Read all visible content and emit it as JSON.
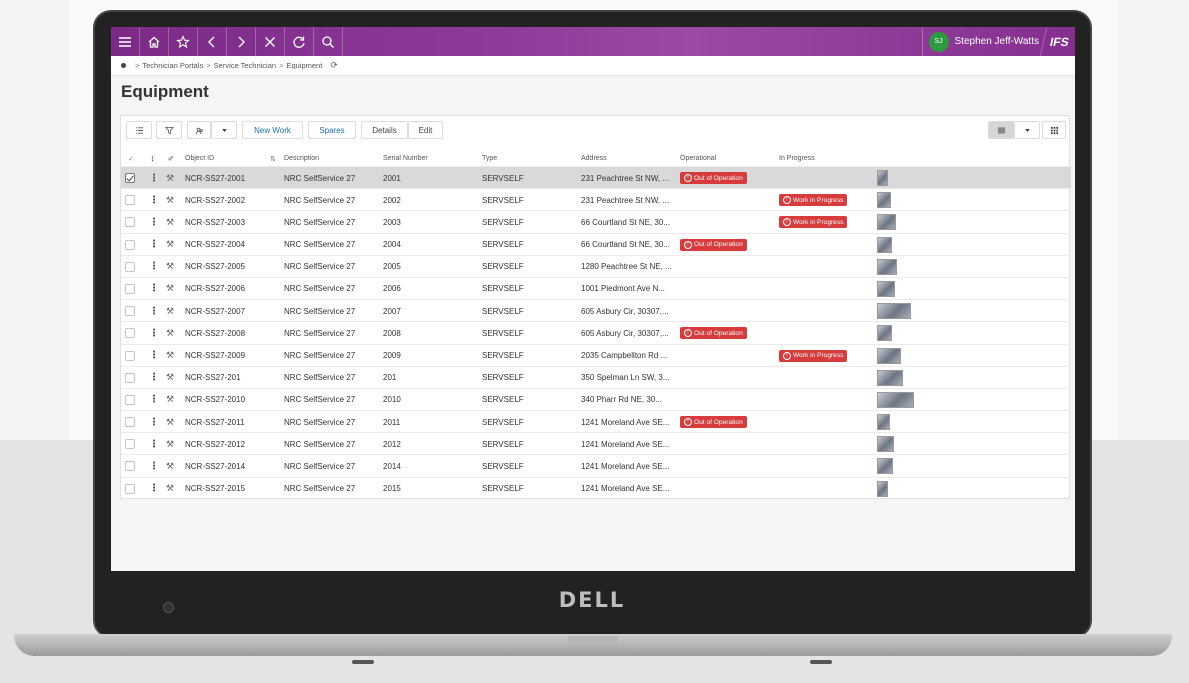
{
  "topbar": {
    "user_name": "Stephen Jeff-Watts",
    "user_initials": "SJ",
    "logo_text": "IFS",
    "colors": {
      "bar": "#8e3a99",
      "avatar": "#2e9a3f"
    },
    "icons": [
      "menu-icon",
      "home-icon",
      "star-icon",
      "chevron-left-icon",
      "chevron-right-icon",
      "close-icon",
      "refresh-icon",
      "search-icon"
    ]
  },
  "breadcrumb": {
    "items": [
      "Technician Portals",
      "Service Technician",
      "Equipment"
    ]
  },
  "page": {
    "title": "Equipment"
  },
  "toolbar": {
    "new_work": "New Work",
    "spares": "Spares",
    "details": "Details",
    "edit": "Edit"
  },
  "table": {
    "columns": {
      "object_id": "Object ID",
      "description": "Description",
      "serial_number": "Serial Number",
      "type": "Type",
      "address": "Address",
      "operational": "Operational",
      "in_progress": "In Progress"
    },
    "rows": [
      {
        "id": "NCR-SS27-2001",
        "desc": "NRC SelfService 27",
        "serial": "2001",
        "type": "SERVSELF",
        "address": "231 Peachtree St NW, ...",
        "operational": "Out of Operation",
        "progress": "",
        "selected": true
      },
      {
        "id": "NCR-SS27-2002",
        "desc": "NRC SelfService 27",
        "serial": "2002",
        "type": "SERVSELF",
        "address": "231 Peachtree St NW, ...",
        "operational": "",
        "progress": "Work in Progress"
      },
      {
        "id": "NCR-SS27-2003",
        "desc": "NRC SelfService 27",
        "serial": "2003",
        "type": "SERVSELF",
        "address": "66 Courtland St NE, 30...",
        "operational": "",
        "progress": "Work in Progress"
      },
      {
        "id": "NCR-SS27-2004",
        "desc": "NRC SelfService 27",
        "serial": "2004",
        "type": "SERVSELF",
        "address": "66 Courtland St NE, 30...",
        "operational": "Out of Operation",
        "progress": ""
      },
      {
        "id": "NCR-SS27-2005",
        "desc": "NRC SelfService 27",
        "serial": "2005",
        "type": "SERVSELF",
        "address": "1280 Peachtree St NE, ...",
        "operational": "",
        "progress": ""
      },
      {
        "id": "NCR-SS27-2006",
        "desc": "NRC SelfService 27",
        "serial": "2006",
        "type": "SERVSELF",
        "address": "1001 Piedmont Ave N...",
        "operational": "",
        "progress": ""
      },
      {
        "id": "NCR-SS27-2007",
        "desc": "NRC SelfService 27",
        "serial": "2007",
        "type": "SERVSELF",
        "address": "605 Asbury Cir, 30307,...",
        "operational": "",
        "progress": ""
      },
      {
        "id": "NCR-SS27-2008",
        "desc": "NRC SelfService 27",
        "serial": "2008",
        "type": "SERVSELF",
        "address": "605 Asbury Cir, 30307,...",
        "operational": "Out of Operation",
        "progress": ""
      },
      {
        "id": "NCR-SS27-2009",
        "desc": "NRC SelfService 27",
        "serial": "2009",
        "type": "SERVSELF",
        "address": "2035 Campbellton Rd ...",
        "operational": "",
        "progress": "Work in Progress"
      },
      {
        "id": "NCR-SS27-201",
        "desc": "NRC SelfService 27",
        "serial": "201",
        "type": "SERVSELF",
        "address": "350 Spelman Ln SW, 3...",
        "operational": "",
        "progress": ""
      },
      {
        "id": "NCR-SS27-2010",
        "desc": "NRC SelfService 27",
        "serial": "2010",
        "type": "SERVSELF",
        "address": "340 Pharr Rd NE, 30...",
        "operational": "",
        "progress": ""
      },
      {
        "id": "NCR-SS27-2011",
        "desc": "NRC SelfService 27",
        "serial": "2011",
        "type": "SERVSELF",
        "address": "1241 Moreland Ave SE...",
        "operational": "Out of Operation",
        "progress": ""
      },
      {
        "id": "NCR-SS27-2012",
        "desc": "NRC SelfService 27",
        "serial": "2012",
        "type": "SERVSELF",
        "address": "1241 Moreland Ave SE...",
        "operational": "",
        "progress": ""
      },
      {
        "id": "NCR-SS27-2014",
        "desc": "NRC SelfService 27",
        "serial": "2014",
        "type": "SERVSELF",
        "address": "1241 Moreland Ave SE...",
        "operational": "",
        "progress": ""
      },
      {
        "id": "NCR-SS27-2015",
        "desc": "NRC SelfService 27",
        "serial": "2015",
        "type": "SERVSELF",
        "address": "1241 Moreland Ave SE...",
        "operational": "",
        "progress": ""
      }
    ],
    "badge_color": "#d83b3b"
  },
  "laptop": {
    "brand": "DELL"
  }
}
